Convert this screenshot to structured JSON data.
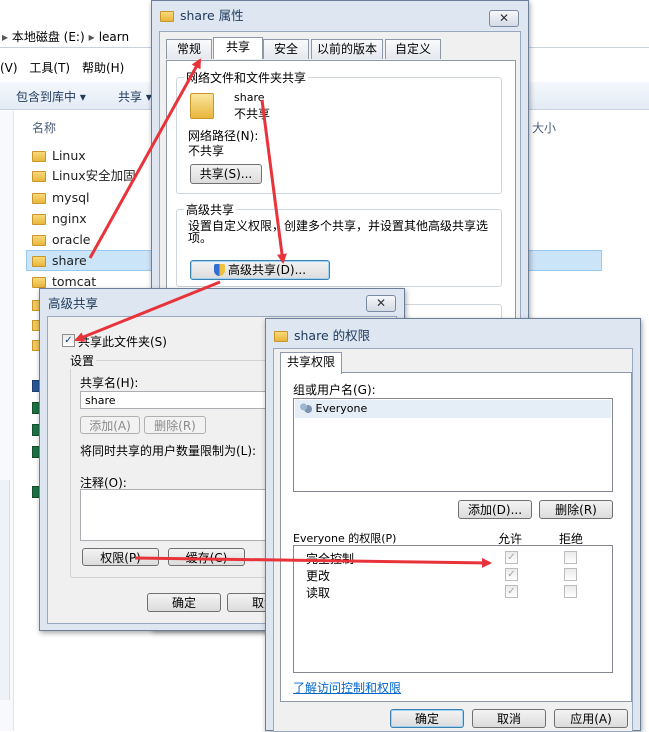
{
  "explorer": {
    "address_drive": "本地磁盘 (E:)",
    "address_sep": "▸",
    "address_folder": "learn",
    "menu_v": "(V)",
    "menu_tools": "工具(T)",
    "menu_help": "帮助(H)",
    "toolbar_include": "包含到库中 ▾",
    "toolbar_share": "共享 ▾",
    "col_name": "名称",
    "col_size": "大小",
    "items": [
      "Linux",
      "Linux安全加固",
      "mysql",
      "nginx",
      "oracle",
      "share",
      "tomcat"
    ]
  },
  "props": {
    "title": "share 属性",
    "tabs": [
      "常规",
      "共享",
      "安全",
      "以前的版本",
      "自定义"
    ],
    "group1_label": "网络文件和文件夹共享",
    "folder_name": "share",
    "folder_state": "不共享",
    "path_label": "网络路径(N):",
    "path_value": "不共享",
    "share_btn": "共享(S)...",
    "group2_label": "高级共享",
    "group2_desc": "设置自定义权限，创建多个共享，并设置其他高级共享选项。",
    "adv_btn": "高级共享(D)..."
  },
  "adv": {
    "title": "高级共享",
    "checkbox_label": "共享此文件夹(S)",
    "settings_label": "设置",
    "share_name_label": "共享名(H):",
    "share_name_value": "share",
    "add_btn": "添加(A)",
    "remove_btn": "删除(R)",
    "limit_label": "将同时共享的用户数量限制为(L):",
    "comment_label": "注释(O):",
    "perm_btn": "权限(P)",
    "cache_btn": "缓存(C)",
    "ok_btn": "确定",
    "cancel_btn": "取消"
  },
  "perm": {
    "title": "share 的权限",
    "tab": "共享权限",
    "group_label": "组或用户名(G):",
    "users": [
      "Everyone"
    ],
    "add_btn": "添加(D)...",
    "remove_btn": "删除(R)",
    "perm_header": "Everyone 的权限(P)",
    "allow_label": "允许",
    "deny_label": "拒绝",
    "rows": [
      {
        "name": "完全控制",
        "allow": true,
        "deny": false
      },
      {
        "name": "更改",
        "allow": true,
        "deny": false
      },
      {
        "name": "读取",
        "allow": true,
        "deny": false
      }
    ],
    "link": "了解访问控制和权限",
    "ok_btn": "确定",
    "cancel_btn": "取消",
    "apply_btn": "应用(A)"
  },
  "colors": {
    "arrow": "#e8333a",
    "accent": "#0066cc",
    "selection": "#cce4f7"
  }
}
